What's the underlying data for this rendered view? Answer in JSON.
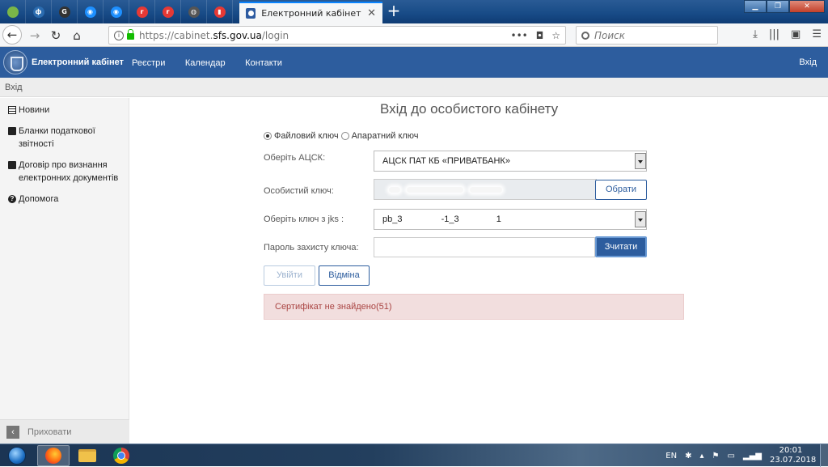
{
  "browser": {
    "pinned_tabs": [
      {
        "icon": "image-icon",
        "color": "#7ab648",
        "glyph": ""
      },
      {
        "icon": "fi-icon",
        "color": "#2b6cb0",
        "glyph": "ф"
      },
      {
        "icon": "quote-icon",
        "color": "#333333",
        "glyph": "G"
      },
      {
        "icon": "target-icon",
        "color": "#1e90ff",
        "glyph": "◉"
      },
      {
        "icon": "target-icon",
        "color": "#1e90ff",
        "glyph": "◉"
      },
      {
        "icon": "r-icon",
        "color": "#e53935",
        "glyph": "r"
      },
      {
        "icon": "r-icon",
        "color": "#e53935",
        "glyph": "r"
      },
      {
        "icon": "globe-icon",
        "color": "#555555",
        "glyph": "◍"
      },
      {
        "icon": "bars-icon",
        "color": "#e53935",
        "glyph": "▮"
      }
    ],
    "active_tab_title": "Електронний кабінет платника",
    "url_prefix": "https://cabinet.",
    "url_domain": "sfs.gov.ua",
    "url_path": "/login",
    "search_placeholder": "Поиск"
  },
  "site": {
    "brand": "Електронний кабінет",
    "menu": [
      "Реєстри",
      "Календар",
      "Контакти"
    ],
    "login": "Вхід",
    "breadcrumb": "Вхід"
  },
  "sidebar": {
    "items": [
      {
        "label": "Новини",
        "icon": "newspaper-icon"
      },
      {
        "label": "Бланки податкової звітності",
        "icon": "book-icon"
      },
      {
        "label": "Договір про визнання електронних документів",
        "icon": "book-icon"
      },
      {
        "label": "Допомога",
        "icon": "question-icon"
      }
    ],
    "collapse_label": "Приховати"
  },
  "login_form": {
    "title": "Вхід до особистого кабінету",
    "radio_file": "Файловий ключ",
    "radio_hardware": "Апаратний ключ",
    "selected_mode": "file",
    "acsk_label": "Оберіть АЦСК:",
    "acsk_value": "АЦСК ПАТ КБ «ПРИВАТБАНК»",
    "key_label": "Особистий ключ:",
    "browse_button": "Обрати",
    "jks_label": "Оберіть ключ з jks :",
    "jks_value_parts": [
      "pb_3",
      "-1_3",
      "1"
    ],
    "password_label": "Пароль захисту ключа:",
    "read_button": "Зчитати",
    "login_button": "Увійти",
    "cancel_button": "Відміна",
    "error_message": "Сертифікат не знайдено(51)"
  },
  "taskbar": {
    "lang": "EN",
    "time": "20:01",
    "date": "23.07.2018"
  }
}
